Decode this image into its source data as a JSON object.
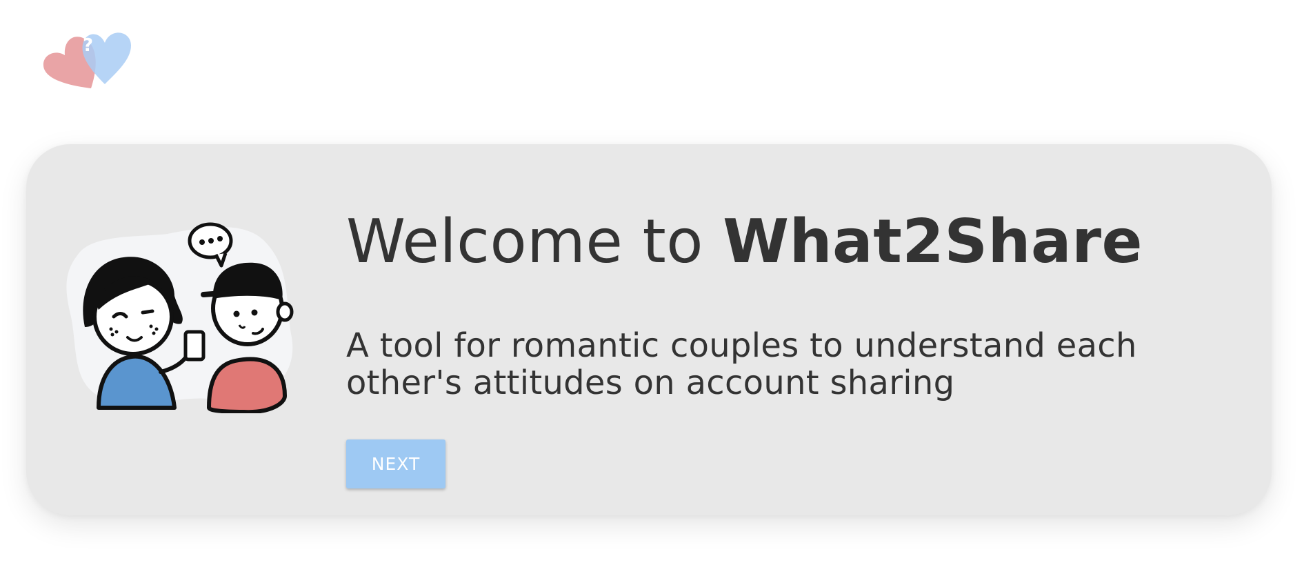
{
  "header": {
    "logo_icon": "two-hearts-question-icon",
    "logo_mark": "?"
  },
  "welcome": {
    "title_prefix": "Welcome to ",
    "title_brand": "What2Share",
    "subtitle": "A tool for romantic couples to understand each other's attitudes on account sharing",
    "next_label": "NEXT"
  },
  "illustration": {
    "icon": "couple-chatting-illustration"
  },
  "colors": {
    "heart_red": "#e79a9c",
    "heart_blue": "#a9cdf5",
    "button": "#9ec9f3",
    "card_bg": "#e8e8e8",
    "text": "#333333",
    "shirt_blue": "#5a95cf",
    "shirt_red": "#e07875"
  }
}
